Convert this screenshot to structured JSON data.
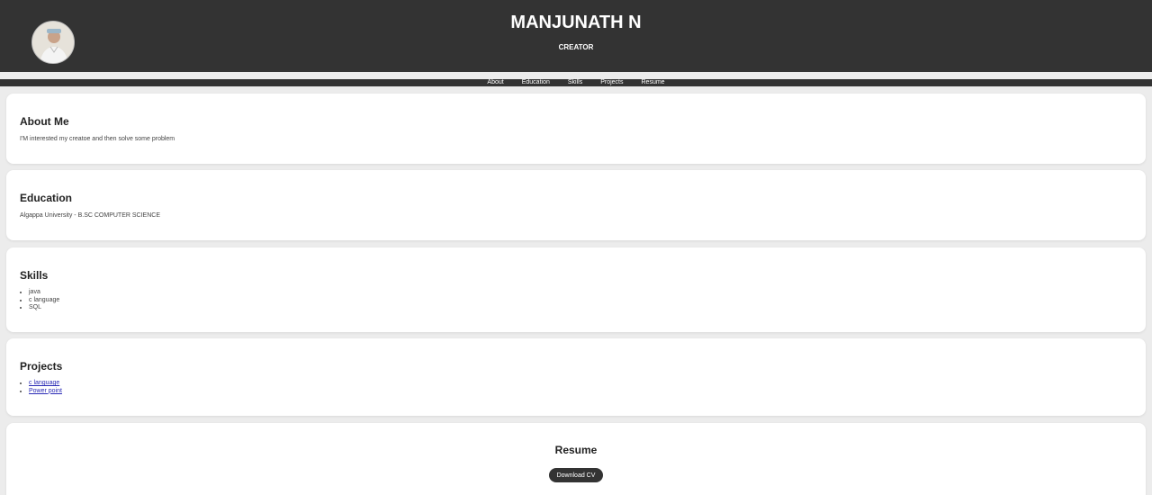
{
  "header": {
    "name": "MANJUNATH N",
    "role": "CREATOR",
    "avatar_icon": "profile-photo"
  },
  "nav": {
    "items": [
      "About",
      "Education",
      "Skills",
      "Projects",
      "Resume"
    ]
  },
  "about": {
    "heading": "About Me",
    "text": "I'M interested my creatoe and then solve some problem"
  },
  "education": {
    "heading": "Education",
    "text": "Algappa University - B.SC COMPUTER SCIENCE"
  },
  "skills": {
    "heading": "Skills",
    "items": [
      "java",
      "c language",
      "SQL"
    ]
  },
  "projects": {
    "heading": "Projects",
    "items": [
      "c language",
      "Power point"
    ]
  },
  "resume": {
    "heading": "Resume",
    "button_label": "Download CV"
  },
  "colors": {
    "header_bg": "#333333",
    "page_bg": "#ececec",
    "link": "#2a2ab5"
  }
}
